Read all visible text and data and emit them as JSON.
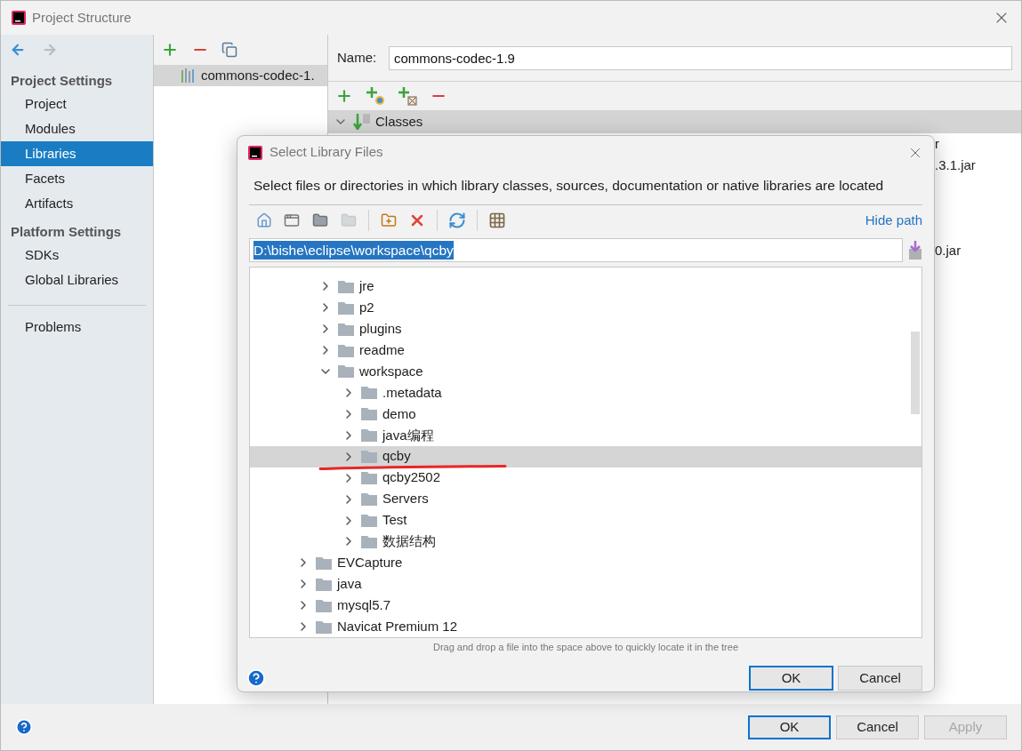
{
  "window": {
    "title": "Project Structure"
  },
  "sidebar": {
    "groups": [
      {
        "header": "Project Settings",
        "items": [
          {
            "label": "Project",
            "selected": false
          },
          {
            "label": "Modules",
            "selected": false
          },
          {
            "label": "Libraries",
            "selected": true
          },
          {
            "label": "Facets",
            "selected": false
          },
          {
            "label": "Artifacts",
            "selected": false
          }
        ]
      },
      {
        "header": "Platform Settings",
        "items": [
          {
            "label": "SDKs",
            "selected": false
          },
          {
            "label": "Global Libraries",
            "selected": false
          }
        ]
      }
    ],
    "bottom_items": [
      {
        "label": "Problems",
        "selected": false
      }
    ]
  },
  "libraries": [
    {
      "name": "commons-codec-1.",
      "selected": true
    }
  ],
  "details": {
    "name_label": "Name:",
    "name_value": "commons-codec-1.9",
    "classes_header": "Classes",
    "class_rows_upper": [
      "r",
      ".3.1.jar"
    ],
    "class_rows_lower": [
      "0.jar"
    ]
  },
  "dialog": {
    "title": "Select Library Files",
    "description": "Select files or directories in which library classes, sources, documentation or native libraries are located",
    "hide_path": "Hide path",
    "path": "D:\\bishe\\eclipse\\workspace\\qcby",
    "tree": {
      "children_of_scrolled_parent": [
        {
          "name": "jre",
          "expanded": false,
          "selected": false
        },
        {
          "name": "p2",
          "expanded": false,
          "selected": false
        },
        {
          "name": "plugins",
          "expanded": false,
          "selected": false
        },
        {
          "name": "readme",
          "expanded": false,
          "selected": false
        },
        {
          "name": "workspace",
          "expanded": true,
          "selected": false,
          "children": [
            {
              "name": ".metadata",
              "expanded": false,
              "selected": false
            },
            {
              "name": "demo",
              "expanded": false,
              "selected": false
            },
            {
              "name": "java编程",
              "expanded": false,
              "selected": false
            },
            {
              "name": "qcby",
              "expanded": false,
              "selected": true
            },
            {
              "name": "qcby2502",
              "expanded": false,
              "selected": false
            },
            {
              "name": "Servers",
              "expanded": false,
              "selected": false
            },
            {
              "name": "Test",
              "expanded": false,
              "selected": false
            },
            {
              "name": "数据结构",
              "expanded": false,
              "selected": false
            }
          ]
        }
      ],
      "items": [
        {
          "name": "EVCapture",
          "expanded": false,
          "selected": false
        },
        {
          "name": "java",
          "expanded": false,
          "selected": false
        },
        {
          "name": "mysql5.7",
          "expanded": false,
          "selected": false
        },
        {
          "name": "Navicat Premium 12",
          "expanded": false,
          "selected": false
        }
      ]
    },
    "hint": "Drag and drop a file into the space above to quickly locate it in the tree",
    "buttons": [
      {
        "label": "OK",
        "default": true
      },
      {
        "label": "Cancel",
        "default": false
      }
    ]
  },
  "buttons": [
    {
      "label": "OK",
      "default": true,
      "disabled": false
    },
    {
      "label": "Cancel",
      "default": false,
      "disabled": false
    },
    {
      "label": "Apply",
      "default": false,
      "disabled": true
    }
  ]
}
